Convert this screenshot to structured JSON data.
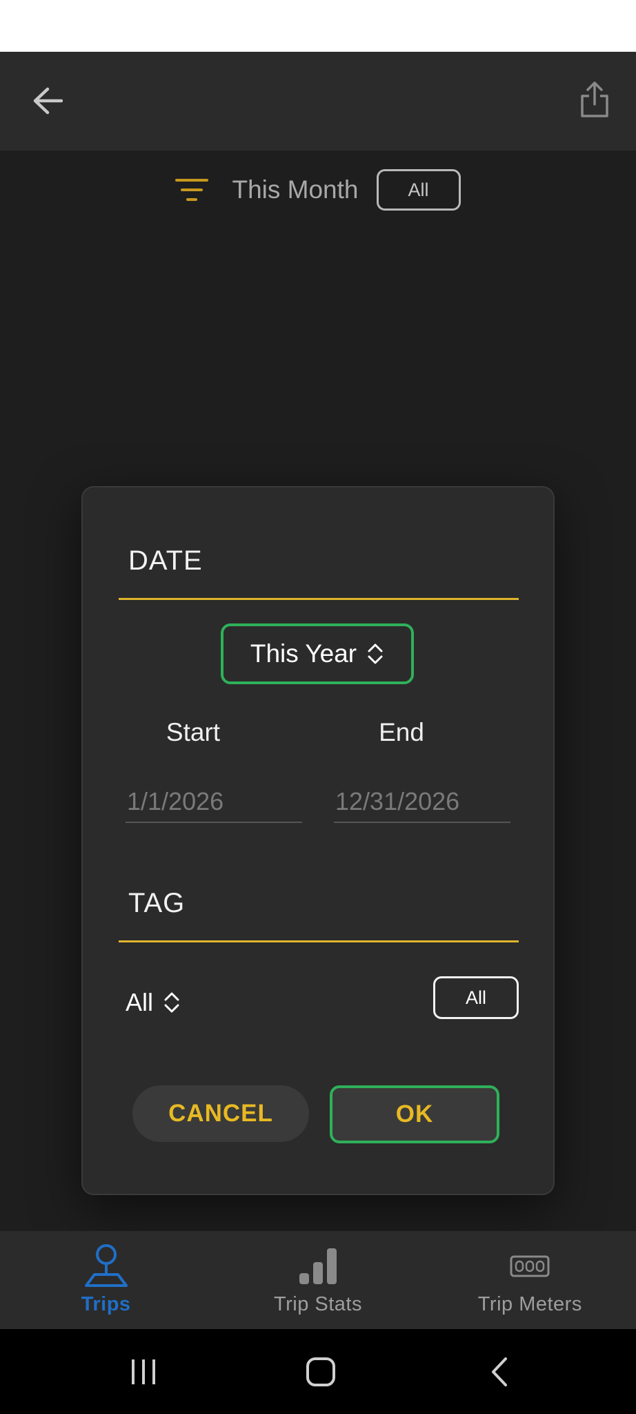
{
  "app_bar": {
    "back_icon": "arrow-left-icon",
    "share_icon": "share-icon"
  },
  "filter": {
    "icon": "filter-icon",
    "period_label": "This Month",
    "tag_pill": "All"
  },
  "dialog": {
    "date_title": "DATE",
    "period_select": "This Year",
    "start_label": "Start",
    "end_label": "End",
    "start_placeholder": "1/1/2026",
    "end_placeholder": "12/31/2026",
    "tag_title": "TAG",
    "tag_select": "All",
    "tag_pill": "All",
    "cancel_label": "CANCEL",
    "ok_label": "OK"
  },
  "bottom_nav": {
    "items": [
      {
        "label": "Trips",
        "icon": "trips-joystick-icon",
        "active": true
      },
      {
        "label": "Trip Stats",
        "icon": "bar-chart-icon",
        "active": false
      },
      {
        "label": "Trip Meters",
        "icon": "odometer-icon",
        "active": false
      }
    ]
  },
  "colors": {
    "accent_yellow": "#e0b52a",
    "selected_green": "#2fb05a",
    "active_blue": "#1f6fc7",
    "surface": "#2b2b2b",
    "background": "#212121"
  }
}
